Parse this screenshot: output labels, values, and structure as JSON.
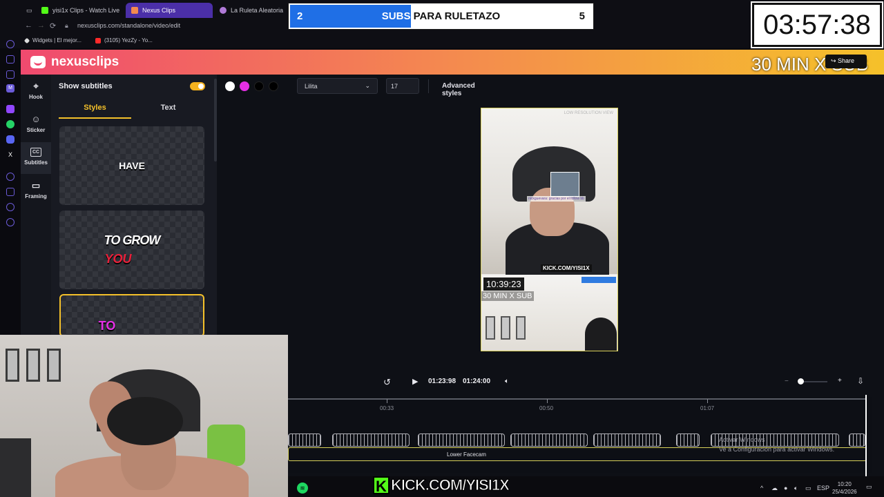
{
  "browser": {
    "tabs": [
      {
        "label": "yisi1x Clips - Watch Live o",
        "color": "#53fc18"
      },
      {
        "label": "Nexus Clips",
        "color": "#f48a4f"
      },
      {
        "label": "La Ruleta Aleatoria",
        "color": "#b07ad8"
      }
    ],
    "url": "nexusclips.com/standalone/video/edit",
    "bookmarks": [
      {
        "label": "Widgets | El mejor...",
        "color": "#dddddd"
      },
      {
        "label": "(3105) YezZy - Yo...",
        "color": "#ff2a2a"
      }
    ]
  },
  "app": {
    "brand": "nexusclips",
    "rail": [
      {
        "label": "Hook",
        "icon": "pointer-icon"
      },
      {
        "label": "Sticker",
        "icon": "sticker-icon"
      },
      {
        "label": "Subtitles",
        "icon": "cc-icon"
      },
      {
        "label": "Framing",
        "icon": "camera-icon"
      }
    ],
    "panel": {
      "title": "Show subtitles",
      "tabs": [
        "Styles",
        "Text"
      ],
      "styles": [
        {
          "line1": "HAVE",
          "line2": ""
        },
        {
          "line1": "TO GROW",
          "line2": "YOU"
        },
        {
          "line1": "TO",
          "line2": ""
        }
      ]
    },
    "toolbar": {
      "swatches": [
        "#ffffff",
        "#e52fe5",
        "#000000",
        "#000000"
      ],
      "font": "Lilita",
      "size": "17",
      "advanced": "Advanced styles"
    },
    "preview": {
      "lowres": "LOW RESOLUTION VIEW",
      "chat": "nickguevara: gracias por el follow bb",
      "kick": "KICK.COM/YISI1X",
      "clock": "10:39:23",
      "thirty": "30 MIN X SUB"
    },
    "player": {
      "current": "01:23:98",
      "total": "01:24:00"
    },
    "timeline": {
      "ticks": [
        "00:33",
        "00:50",
        "01:07"
      ],
      "lower_track": "Lower Facecam",
      "activate_line1": "Activar Windows",
      "activate_line2": "Ve a Configuración para activar Windows."
    }
  },
  "overlay": {
    "subs_have": "2",
    "subs_text_a": "SUBS",
    "subs_text_b": " PARA RULETAZO",
    "subs_goal": "5",
    "subs_progress": 0.4,
    "timer": "03:57:38",
    "thirty": "30 MIN X SUB",
    "share": "Share",
    "kick_text": "KICK.COM/YISI1X"
  },
  "taskbar": {
    "lang": "ESP",
    "time": "10:20",
    "date": "25/4/2026"
  }
}
